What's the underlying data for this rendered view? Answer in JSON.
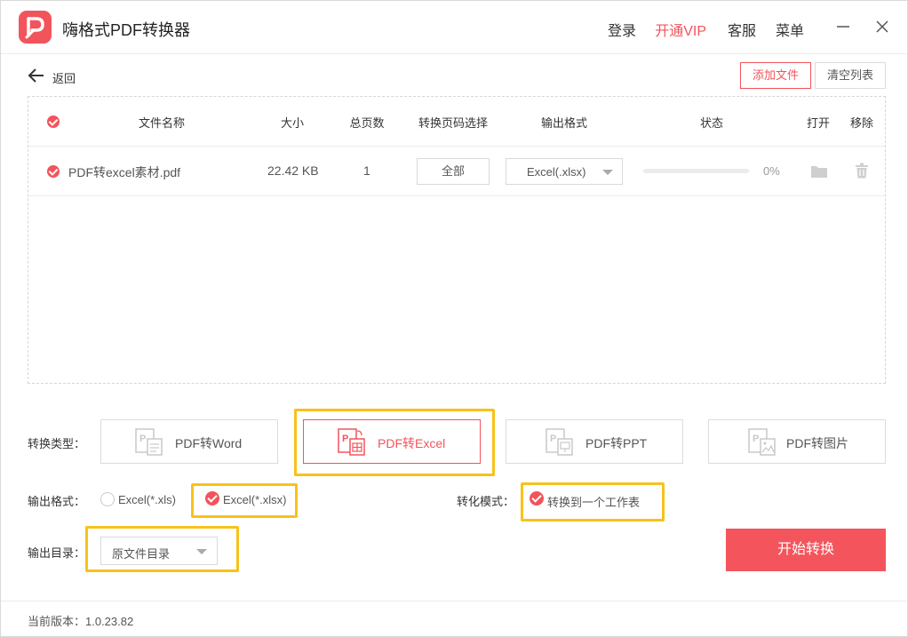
{
  "app": {
    "title": "嗨格式PDF转换器"
  },
  "top_menu": {
    "login": "登录",
    "vip": "开通VIP",
    "service": "客服",
    "menu": "菜单"
  },
  "nav": {
    "back_label": "返回",
    "add_file": "添加文件",
    "clear_list": "清空列表"
  },
  "table": {
    "headers": {
      "name": "文件名称",
      "size": "大小",
      "pages": "总页数",
      "page_select": "转换页码选择",
      "format": "输出格式",
      "status": "状态",
      "open": "打开",
      "remove": "移除"
    },
    "rows": [
      {
        "name": "PDF转excel素材.pdf",
        "size": "22.42 KB",
        "pages": "1",
        "page_select": "全部",
        "format": "Excel(.xlsx)",
        "progress": 0,
        "progress_text": "0%"
      }
    ]
  },
  "conversion": {
    "type_label": "转换类型：",
    "types": [
      {
        "label": "PDF转Word",
        "icon": "pdf-word-icon"
      },
      {
        "label": "PDF转Excel",
        "icon": "pdf-excel-icon"
      },
      {
        "label": "PDF转PPT",
        "icon": "pdf-ppt-icon"
      },
      {
        "label": "PDF转图片",
        "icon": "pdf-image-icon"
      }
    ],
    "active_type": "PDF转Excel",
    "format_label": "输出格式：",
    "format_options": [
      "Excel(*.xls)",
      "Excel(*.xlsx)"
    ],
    "selected_format": "Excel(*.xlsx)",
    "mode_label": "转化模式：",
    "mode_option": "转换到一个工作表",
    "output_dir_label": "输出目录：",
    "output_dir_value": "原文件目录",
    "start_button": "开始转换"
  },
  "footer": {
    "version": "当前版本：1.0.23.82"
  },
  "colors": {
    "accent": "#f2545b",
    "highlight": "#f7c21a"
  }
}
